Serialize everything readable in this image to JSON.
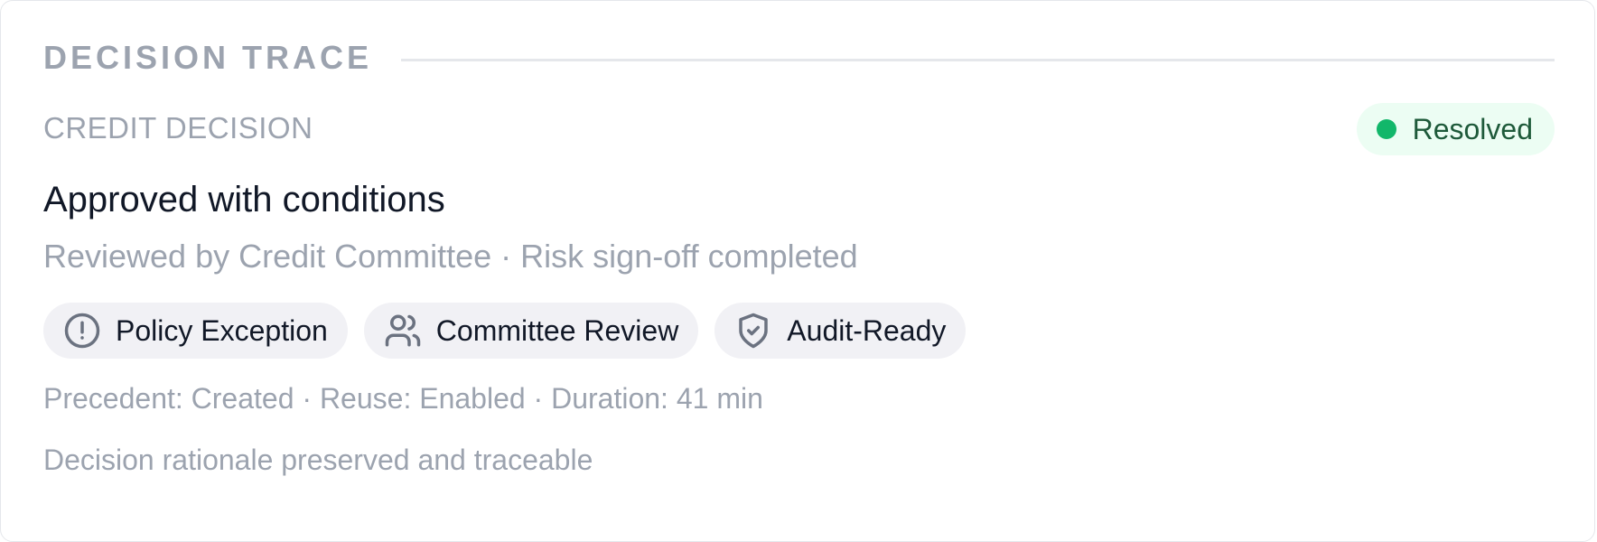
{
  "section": {
    "title": "DECISION TRACE"
  },
  "decision": {
    "category": "CREDIT DECISION",
    "status": {
      "label": "Resolved",
      "color": "#12b76a"
    },
    "headline": "Approved with conditions",
    "subline": "Reviewed by Credit Committee · Risk sign-off completed",
    "tags": [
      {
        "label": "Policy Exception",
        "icon": "alert-circle-icon"
      },
      {
        "label": "Committee Review",
        "icon": "users-icon"
      },
      {
        "label": "Audit-Ready",
        "icon": "shield-check-icon"
      }
    ],
    "meta": "Precedent: Created · Reuse: Enabled · Duration: 41 min",
    "footnote": "Decision rationale preserved and traceable"
  }
}
